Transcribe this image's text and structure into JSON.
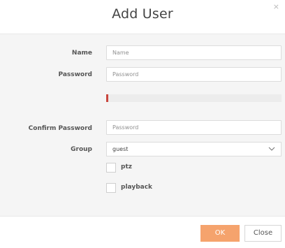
{
  "dialog": {
    "title": "Add User",
    "close_glyph": "×",
    "close_icon": "close-icon"
  },
  "form": {
    "name": {
      "label": "Name",
      "placeholder": "Name",
      "value": ""
    },
    "password": {
      "label": "Password",
      "placeholder": "Password",
      "value": ""
    },
    "password_strength": {
      "level": 0.01,
      "color": "#c9453d"
    },
    "confirm_password": {
      "label": "Confirm Password",
      "placeholder": "Password",
      "value": ""
    },
    "group": {
      "label": "Group",
      "selected": "guest",
      "icon": "chevron-down-icon"
    },
    "permissions": [
      {
        "label": "ptz",
        "checked": false
      },
      {
        "label": "playback",
        "checked": false
      }
    ]
  },
  "footer": {
    "ok_label": "OK",
    "close_label": "Close"
  },
  "colors": {
    "accent": "#f5a36d",
    "strength_weak": "#c9453d"
  }
}
